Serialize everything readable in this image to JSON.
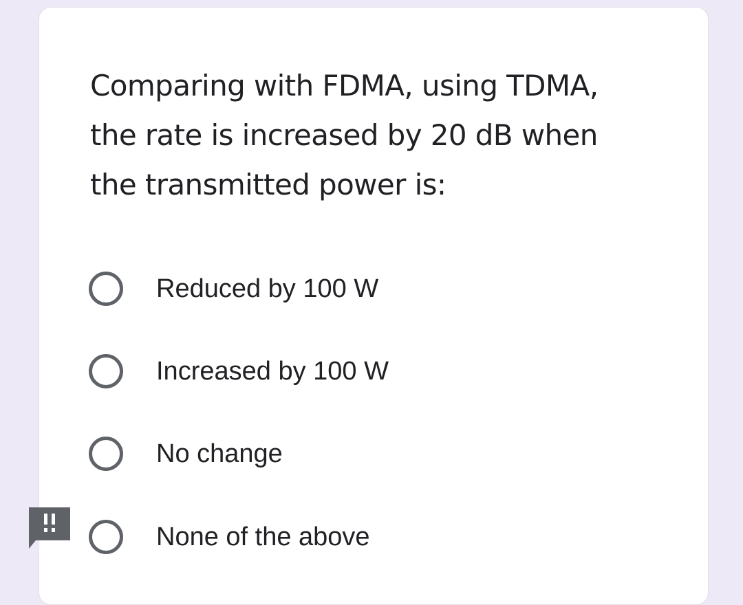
{
  "question": {
    "lines": [
      "Comparing with FDMA, using TDMA,",
      "the rate is increased by 20 dB when",
      "the transmitted power is:"
    ]
  },
  "options": [
    {
      "label": "Reduced by 100 W",
      "selected": false
    },
    {
      "label": "Increased by 100 W",
      "selected": false
    },
    {
      "label": "No change",
      "selected": false
    },
    {
      "label": "None of the above",
      "selected": false
    }
  ],
  "warning_badge": {
    "icon": "exclamation-icon",
    "color": "#5f6368"
  },
  "colors": {
    "background": "#ede9f6",
    "card": "#ffffff",
    "text": "#202124",
    "radio_border": "#5f6368"
  }
}
